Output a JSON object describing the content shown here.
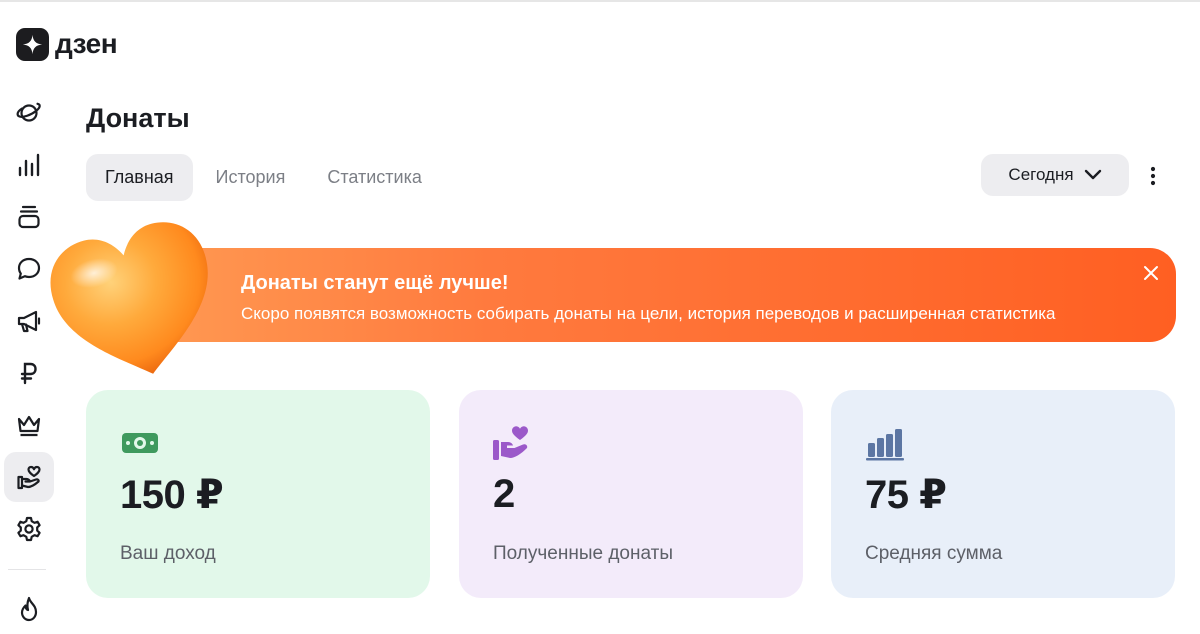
{
  "app": {
    "logo_text": "дзен"
  },
  "sidebar": {
    "items": [
      {
        "icon": "planet-icon"
      },
      {
        "icon": "bar-chart-icon"
      },
      {
        "icon": "stack-icon"
      },
      {
        "icon": "chat-bubble-icon"
      },
      {
        "icon": "megaphone-icon"
      },
      {
        "icon": "ruble-icon"
      },
      {
        "icon": "crown-icon"
      },
      {
        "icon": "donate-hand-heart-icon",
        "active": true
      },
      {
        "icon": "gear-icon"
      },
      {
        "icon": "fire-icon"
      }
    ]
  },
  "header": {
    "title": "Донаты",
    "tabs": [
      {
        "label": "Главная",
        "active": true
      },
      {
        "label": "История"
      },
      {
        "label": "Статистика"
      }
    ],
    "period": {
      "label": "Сегодня",
      "icon": "chevron-down-icon"
    },
    "more_icon": "more-vertical-icon"
  },
  "banner": {
    "title": "Донаты станут ещё лучше!",
    "text": "Скоро появятся возможность собирать донаты на цели, история переводов и расширенная статистика",
    "close_icon": "close-icon",
    "image": "orange-heart-illustration",
    "colors": {
      "from": "#ff9c54",
      "to": "#ff5f22"
    }
  },
  "stats": [
    {
      "value": "150 ₽",
      "label": "Ваш доход",
      "icon": "money-bill-icon",
      "bg": "#e2f8ea",
      "accent": "#3f9a5e"
    },
    {
      "value": "2",
      "label": "Полученные донаты",
      "icon": "hand-heart-icon",
      "bg": "#f3ebfa",
      "accent": "#9b59c9"
    },
    {
      "value": "75 ₽",
      "label": "Средняя сумма",
      "icon": "bar-chart-icon",
      "bg": "#e8eff9",
      "accent": "#5c76a3"
    }
  ]
}
